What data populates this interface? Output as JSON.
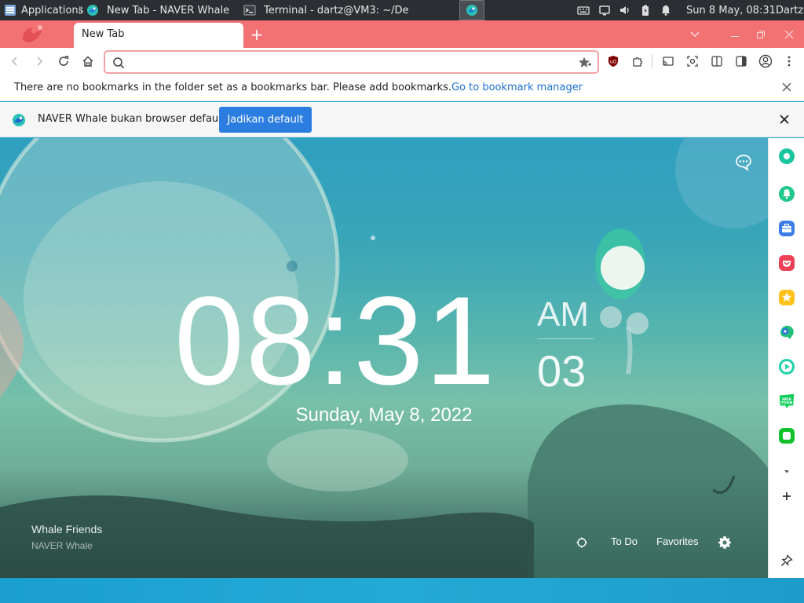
{
  "taskbar": {
    "applications_label": "Applications",
    "windows": [
      {
        "title": "New Tab - NAVER Whale",
        "active": true
      },
      {
        "title": "Terminal - dartz@VM3: ~/De...",
        "active": false
      }
    ],
    "clock": "Sun  8 May, 08:31",
    "user": "Dartz"
  },
  "browser": {
    "tab_title": "New Tab",
    "omnibox": {
      "value": "",
      "placeholder": ""
    },
    "bookmark_bar": {
      "message": "There are no bookmarks in the folder set as a bookmarks bar. Please add bookmarks.",
      "link": "Go to bookmark manager"
    },
    "infobar": {
      "message": "NAVER Whale bukan browser default",
      "button": "Jadikan default"
    },
    "colors": {
      "tabstrip": "#f27173",
      "accent_button": "#2b7de0"
    }
  },
  "newtab": {
    "time": "08:31",
    "ampm": "AM",
    "seconds": "03",
    "date": "Sunday, May 8, 2022",
    "credit_title": "Whale Friends",
    "credit_subtitle": "NAVER Whale",
    "buttons": {
      "todo": "To Do",
      "favorites": "Favorites"
    }
  },
  "sidebar": {
    "apps": [
      "whale-space-icon",
      "notification-icon",
      "briefcase-icon",
      "pocket-icon",
      "star-icon",
      "translate-icon",
      "play-icon",
      "webtoon-icon",
      "line-icon"
    ]
  }
}
